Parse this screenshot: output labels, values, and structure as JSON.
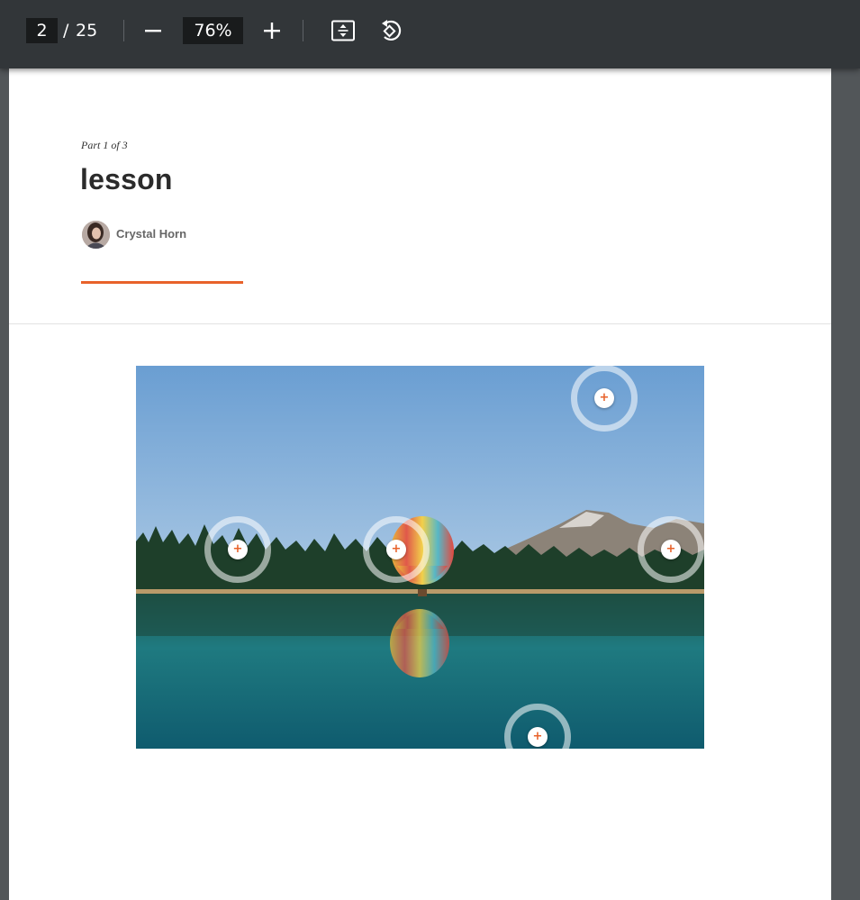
{
  "toolbar": {
    "current_page": "2",
    "separator": "/",
    "total_pages": "25",
    "zoom": "76%",
    "icons": [
      "minus-icon",
      "plus-icon",
      "fit-page-icon",
      "rotate-icon"
    ]
  },
  "document": {
    "part_label": "Part 1 of 3",
    "title": "lesson",
    "author": "Crystal Horn",
    "accent_color": "#e8622a"
  },
  "hotspots": [
    {
      "label": "+"
    },
    {
      "label": "+"
    },
    {
      "label": "+"
    },
    {
      "label": "+"
    },
    {
      "label": "+"
    }
  ]
}
